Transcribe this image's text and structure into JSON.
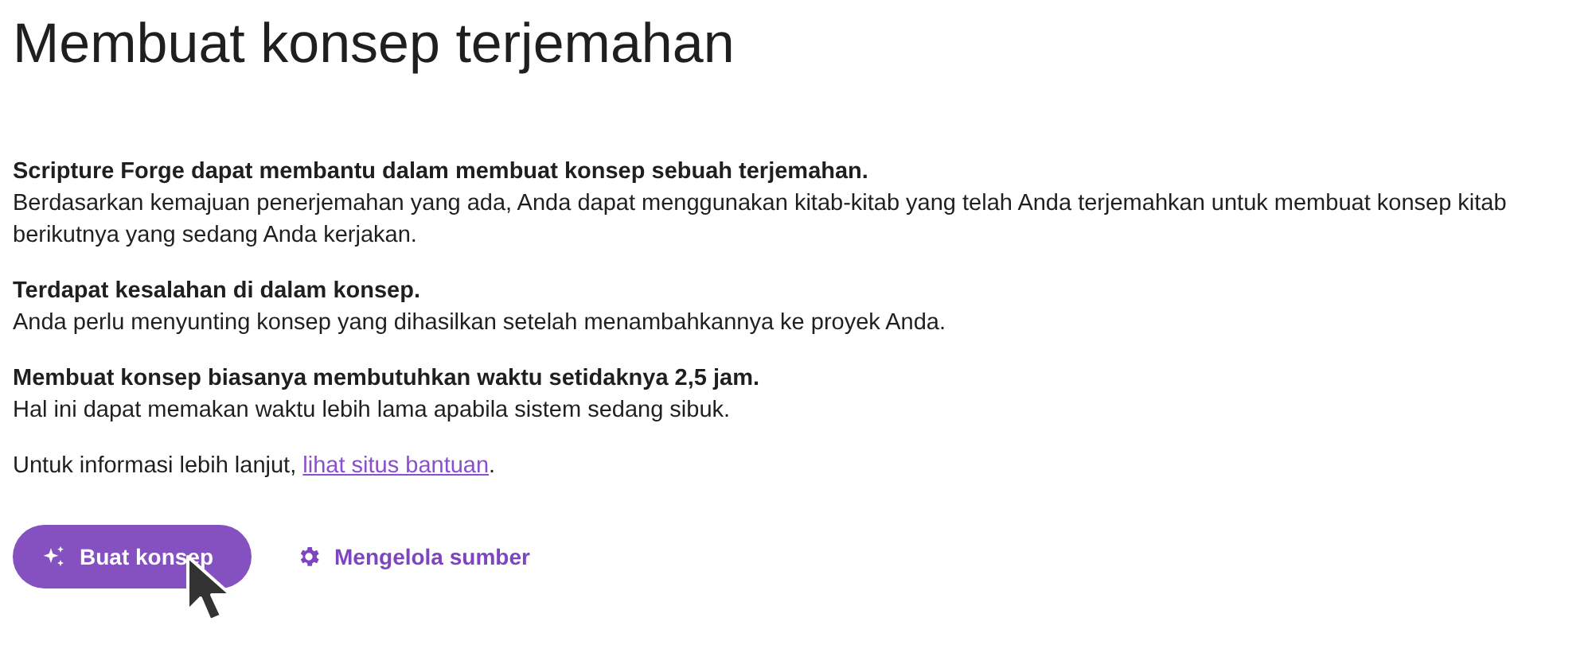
{
  "title": "Membuat konsep terjemahan",
  "sections": [
    {
      "heading": "Scripture Forge dapat membantu dalam membuat konsep sebuah terjemahan.",
      "body": "Berdasarkan kemajuan penerjemahan yang ada, Anda dapat menggunakan kitab-kitab yang telah Anda terjemahkan untuk membuat konsep kitab berikutnya yang sedang Anda kerjakan."
    },
    {
      "heading": "Terdapat kesalahan di dalam konsep.",
      "body": "Anda perlu menyunting konsep yang dihasilkan setelah menambahkannya ke proyek Anda."
    },
    {
      "heading": "Membuat konsep biasanya membutuhkan waktu setidaknya 2,5 jam.",
      "body": "Hal ini dapat memakan waktu lebih lama apabila sistem sedang sibuk."
    }
  ],
  "info": {
    "prefix": "Untuk informasi lebih lanjut, ",
    "link": "lihat situs bantuan",
    "suffix": "."
  },
  "buttons": [
    {
      "kind": "primary",
      "label": "Buat konsep"
    },
    {
      "kind": "text",
      "label": "Mengelola sumber"
    }
  ]
}
